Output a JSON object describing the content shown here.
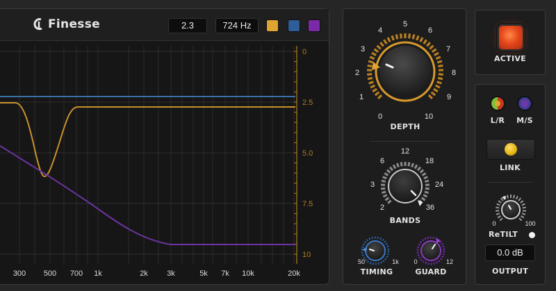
{
  "header": {
    "brand": "Finesse",
    "value_display": "2.3",
    "freq_display": "724 Hz",
    "swatches": [
      "#e0a531",
      "#2f5d9a",
      "#7a2aa6"
    ]
  },
  "graph": {
    "db_labels": [
      "0",
      "2.5",
      "5.0",
      "7.5",
      "10"
    ],
    "freq_labels": [
      "300",
      "500",
      "700",
      "1k",
      "2k",
      "3k",
      "5k",
      "7k",
      "10k",
      "20k"
    ],
    "colors": {
      "orange": "#c9912e",
      "blue": "#3b6fa8",
      "purple": "#6b34a0",
      "axis": "#b07f24"
    }
  },
  "depth": {
    "label": "DEPTH",
    "ticks": [
      "0",
      "1",
      "2",
      "3",
      "4",
      "5",
      "6",
      "7",
      "8",
      "9",
      "10"
    ],
    "value": 2.3
  },
  "bands": {
    "label": "BANDS",
    "ticks": [
      "2",
      "3",
      "6",
      "12",
      "18",
      "24",
      "36"
    ]
  },
  "timing": {
    "label": "TIMING",
    "min": "50",
    "max": "1k"
  },
  "guard": {
    "label": "GUARD",
    "min": "0",
    "max": "12"
  },
  "active": {
    "label": "ACTIVE",
    "color": "#e5481b"
  },
  "stereo": {
    "lr_label": "L/R",
    "ms_label": "M/S",
    "link_label": "LINK",
    "retilt_label": "ReTILT",
    "retilt_min": "0",
    "retilt_max": "100",
    "output_value": "0.0 dB",
    "output_label": "OUTPUT"
  }
}
